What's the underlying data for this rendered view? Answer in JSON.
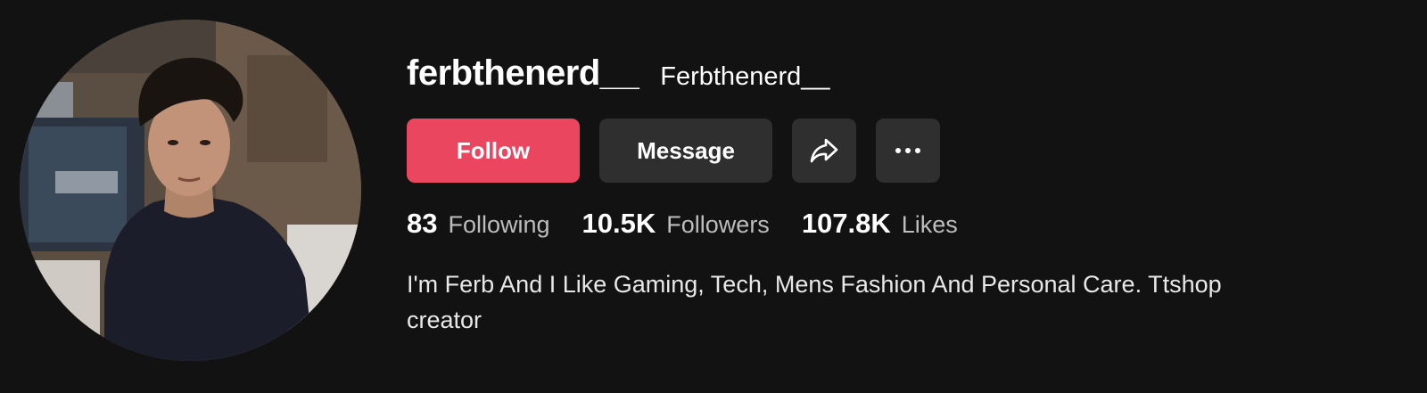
{
  "profile": {
    "username": "ferbthenerd__",
    "nickname": "Ferbthenerd__",
    "bio": "I'm Ferb And I Like Gaming, Tech, Mens Fashion And Personal Care. Ttshop creator"
  },
  "actions": {
    "follow_label": "Follow",
    "message_label": "Message",
    "share_icon": "share-arrow-icon",
    "more_icon": "more-dots-icon"
  },
  "stats": {
    "following": {
      "value": "83",
      "label": "Following"
    },
    "followers": {
      "value": "10.5K",
      "label": "Followers"
    },
    "likes": {
      "value": "107.8K",
      "label": "Likes"
    }
  },
  "colors": {
    "background": "#121212",
    "follow_button": "#EA4660",
    "secondary_button": "#2F2F2F",
    "stat_label": "#BDBDBD"
  }
}
